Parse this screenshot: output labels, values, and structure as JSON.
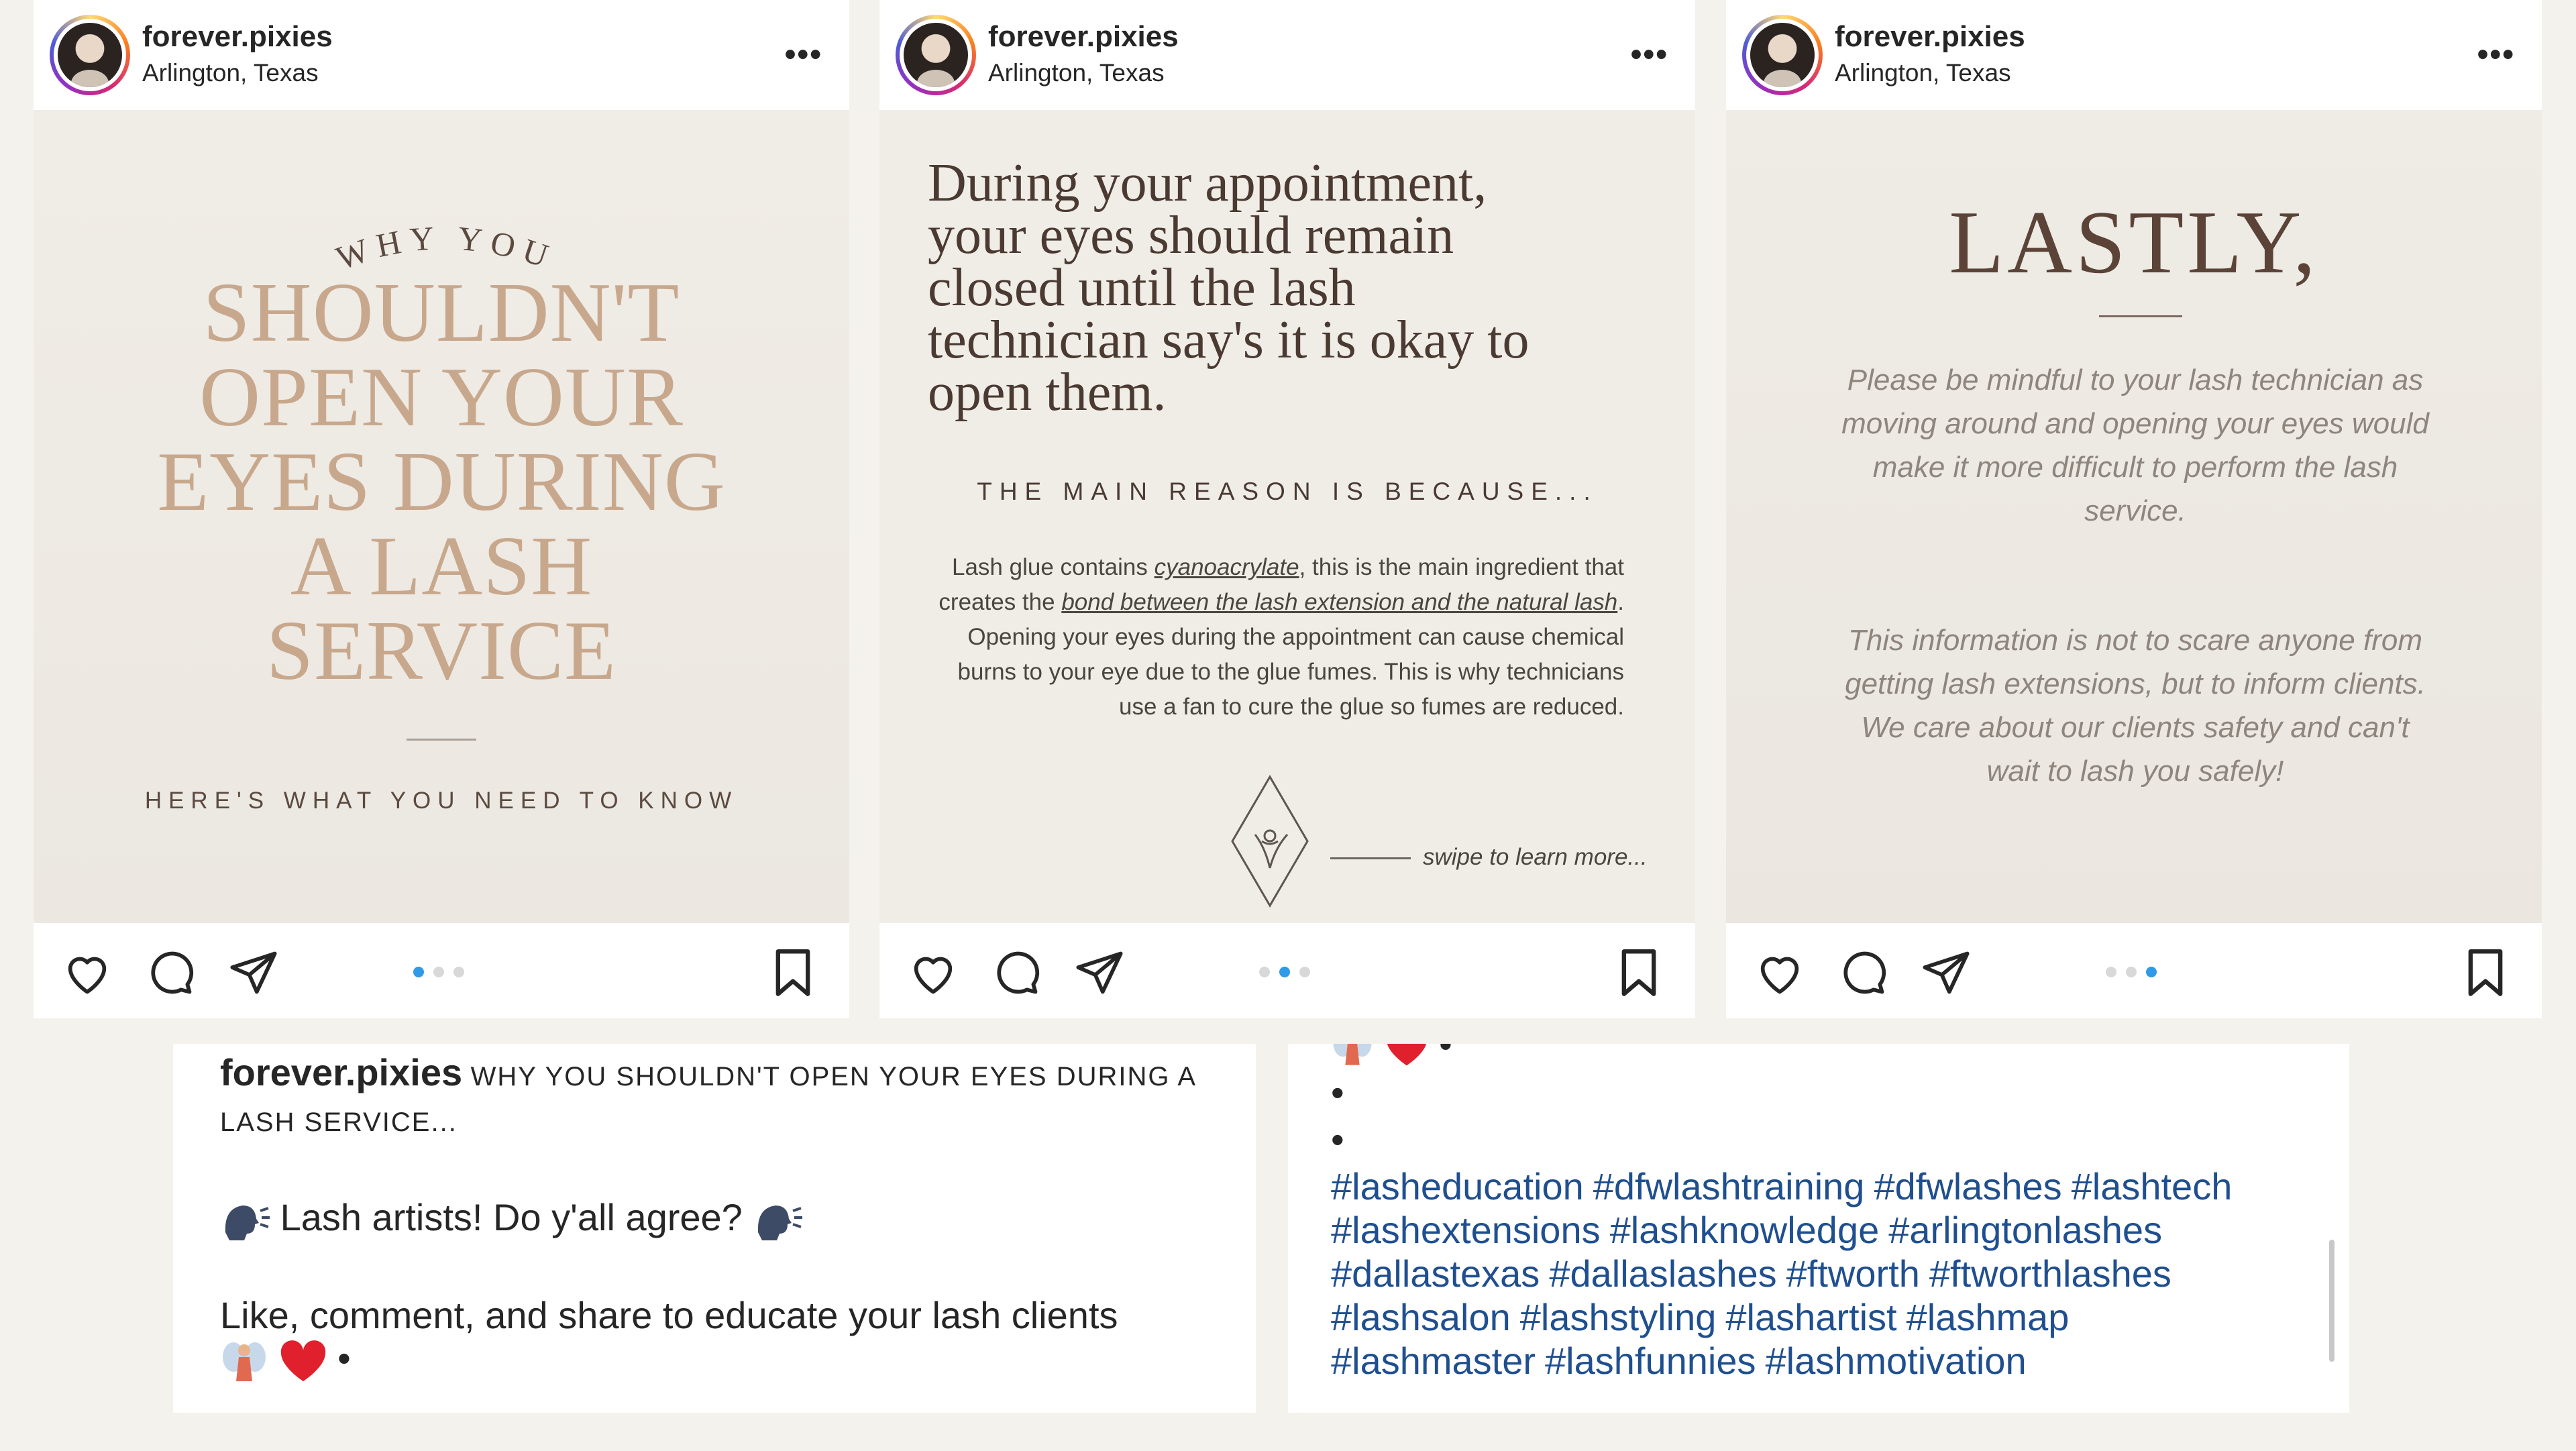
{
  "posts": [
    {
      "username": "forever.pixies",
      "location": "Arlington, Texas",
      "active_dot": 0,
      "slide": {
        "kicker": "WHY YOU",
        "title_lines": [
          "SHOULDN'T",
          "OPEN YOUR",
          "EYES DURING",
          "A LASH",
          "SERVICE"
        ],
        "subtitle": "HERE'S WHAT YOU NEED TO KNOW"
      }
    },
    {
      "username": "forever.pixies",
      "location": "Arlington, Texas",
      "active_dot": 1,
      "slide": {
        "title_lines": [
          "During your appointment,",
          "your eyes should remain",
          "closed until the lash",
          "technician say's it is okay to",
          "open them."
        ],
        "reason_heading": "THE MAIN REASON IS BECAUSE...",
        "body_1": "Lash glue contains ",
        "link_1": "cyanoacrylate",
        "body_2": ", this is the main ingredient that creates the ",
        "link_2": "bond between the lash extension and the natural lash",
        "body_3": ". Opening your eyes during the appointment can cause chemical burns to your eye due to the glue fumes. This is why technicians use a fan to cure the glue so fumes are reduced.",
        "swipe_text": "swipe to learn more..."
      }
    },
    {
      "username": "forever.pixies",
      "location": "Arlington, Texas",
      "active_dot": 2,
      "slide": {
        "title": "LASTLY,",
        "paragraph_1": "Please be mindful to your lash technician as moving around and opening your eyes would make it more difficult to perform the lash service.",
        "paragraph_2": "This information is not to scare anyone from getting lash extensions, but to inform clients. We care about our clients safety and can't wait to lash you safely!"
      }
    }
  ],
  "caption_left": {
    "username": "forever.pixies",
    "headline": "WHY YOU SHOULDN'T OPEN YOUR EYES DURING A LASH SERVICE...",
    "line_2": "Lash artists! Do y'all agree?",
    "line_3": "Like, comment, and share to educate your lash clients",
    "bullet": "•"
  },
  "caption_right": {
    "bullets": [
      "•",
      "•",
      "•"
    ],
    "hashtags": [
      "#lasheducation",
      "#dfwlashtraining",
      "#dfwlashes",
      "#lashtech",
      "#lashextensions",
      "#lashknowledge",
      "#arlingtonlashes",
      "#dallastexas",
      "#dallaslashes",
      "#ftworth",
      "#ftworthlashes",
      "#lashsalon",
      "#lashstyling",
      "#lashartist",
      "#lashmap",
      "#lashmaster",
      "#lashfunnies",
      "#lashmotivation"
    ]
  },
  "colors": {
    "hashtag": "#1f4f8f",
    "dot_active": "#2f9ae8",
    "slide1_title": "#c8a88d",
    "slide_bg": "#f1eee8"
  },
  "icons": [
    "heart-icon",
    "comment-icon",
    "share-icon",
    "bookmark-icon",
    "more-icon",
    "speaking-head-icon",
    "fairy-icon",
    "red-heart-icon"
  ]
}
